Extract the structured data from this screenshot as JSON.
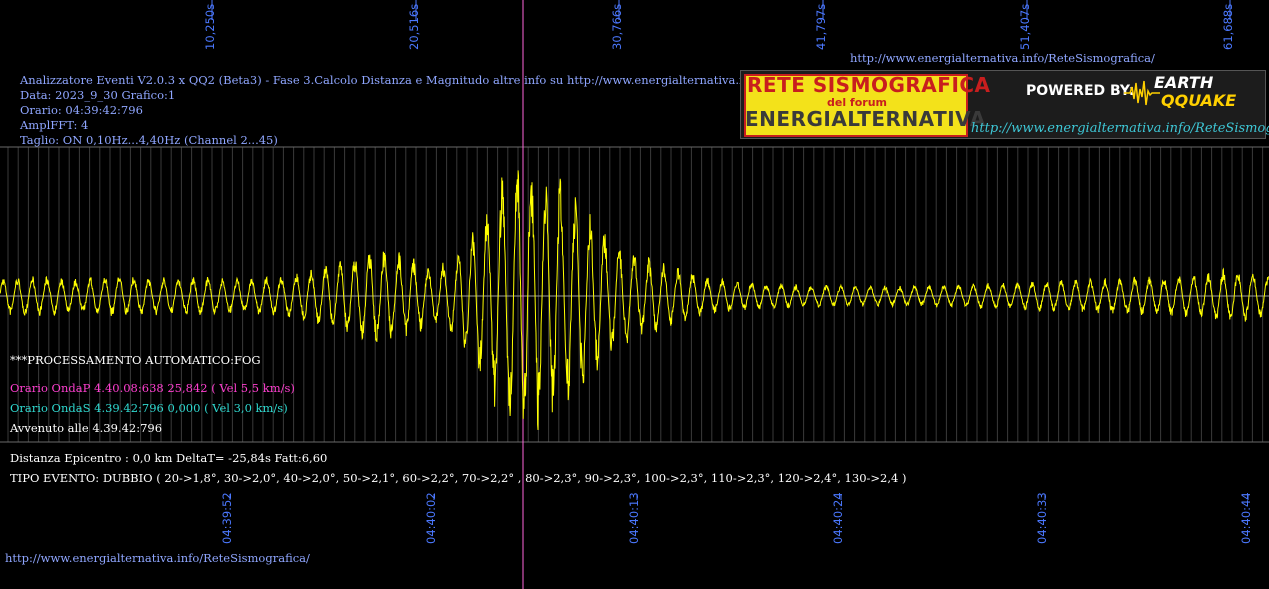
{
  "header": {
    "url_top": "http://www.energialternativa.info/ReteSismografica/",
    "title_line": "Analizzatore Eventi V2.0.3 x QQ2 (Beta3) - Fase 3.Calcolo Distanza e Magnitudo altre info su http://www.energialternativa.info/ReteSism",
    "date_line": "Data: 2023_9_30 Grafico:1",
    "time_line": "Orario: 04:39:42:796",
    "ampl_line": "AmplFFT: 4",
    "filter_line": "Taglio: ON 0,10Hz...4,40Hz       (Channel 2...45)"
  },
  "logo": {
    "line1": "RETE SISMOGRAFICA",
    "line2": "del forum",
    "line3": "ENERGIALTERNATIVA",
    "powered": "POWERED BY:",
    "brand1": "EARTH",
    "brand2": "QQUAKE",
    "url": "http://www.energialternativa.info/ReteSismografica"
  },
  "analysis": {
    "auto": "***PROCESSAMENTO AUTOMATICO:FOG",
    "p_wave": "Orario OndaP 4.40.08:638  25,842 ( Vel 5,5 km/s)",
    "s_wave": "Orario OndaS 4.39.42:796  0,000 ( Vel 3,0 km/s)",
    "occurred": "Avvenuto alle 4.39.42:796",
    "distance": "Distanza Epicentro : 0,0 km DeltaT= -25,84s  Fatt:6,60",
    "event_type": "TIPO EVENTO: DUBBIO ( 20->1,8°, 30->2,0°, 40->2,0°, 50->2,1°, 60->2,2°, 70->2,2° , 80->2,3°, 90->2,3°, 100->2,3°, 110->2,3°, 120->2,4°, 130->2,4 )"
  },
  "url_bottom": "http://www.energialternativa.info/ReteSismografica/",
  "chart_data": {
    "type": "line",
    "top_axis_ticks": [
      "10,250s",
      "20,516s",
      "30,766s",
      "41,797s",
      "51,407s",
      "61,688s"
    ],
    "bottom_axis_ticks": [
      "04:39:52",
      "04:40:02",
      "04:40:13",
      "04:40:24",
      "04:40:33",
      "04:40:44"
    ],
    "series": [
      {
        "color": "#ffff00",
        "envelope": [
          [
            0,
            0.13
          ],
          [
            2,
            0.14
          ],
          [
            4,
            0.12
          ],
          [
            6,
            0.15
          ],
          [
            8,
            0.13
          ],
          [
            10,
            0.14
          ],
          [
            12,
            0.12
          ],
          [
            14,
            0.14
          ],
          [
            16,
            0.2
          ],
          [
            18,
            0.3
          ],
          [
            19,
            0.35
          ],
          [
            20,
            0.32
          ],
          [
            21,
            0.25
          ],
          [
            22,
            0.2
          ],
          [
            23,
            0.3
          ],
          [
            24,
            0.55
          ],
          [
            25,
            0.8
          ],
          [
            26,
            1.0
          ],
          [
            27,
            0.95
          ],
          [
            28,
            0.85
          ],
          [
            29,
            0.7
          ],
          [
            30,
            0.55
          ],
          [
            31,
            0.4
          ],
          [
            32,
            0.3
          ],
          [
            34,
            0.2
          ],
          [
            36,
            0.12
          ],
          [
            40,
            0.08
          ],
          [
            45,
            0.07
          ],
          [
            50,
            0.09
          ],
          [
            55,
            0.12
          ],
          [
            60,
            0.15
          ],
          [
            62,
            0.2
          ],
          [
            64,
            0.15
          ]
        ]
      }
    ],
    "marker_line_color": "#ff66dd"
  }
}
